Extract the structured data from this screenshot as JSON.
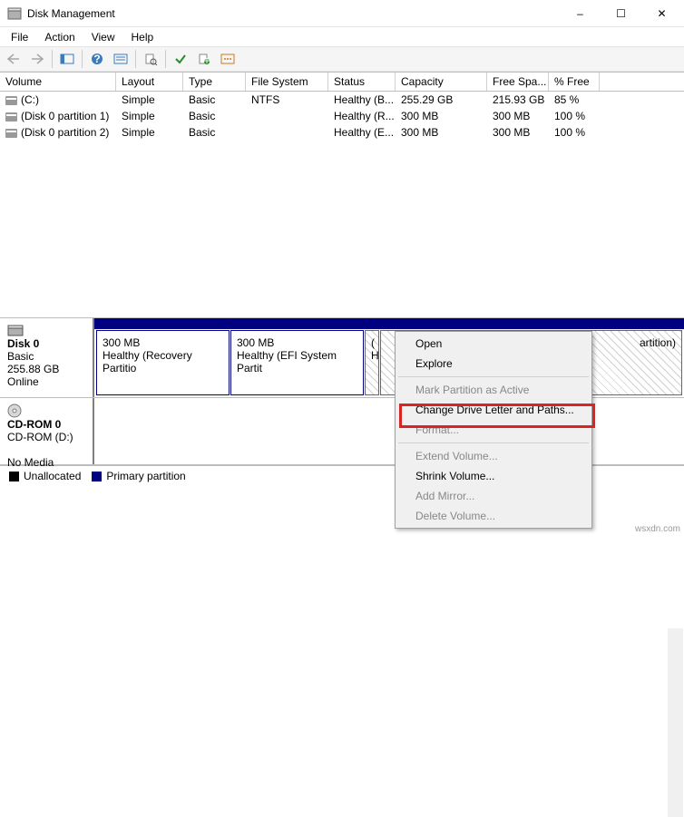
{
  "window": {
    "title": "Disk Management",
    "buttons": {
      "min": "–",
      "max": "☐",
      "close": "✕"
    }
  },
  "menu": {
    "file": "File",
    "action": "Action",
    "view": "View",
    "help": "Help"
  },
  "columns": {
    "volume": "Volume",
    "layout": "Layout",
    "type": "Type",
    "fs": "File System",
    "status": "Status",
    "capacity": "Capacity",
    "free": "Free Spa...",
    "pfree": "% Free"
  },
  "volumes": [
    {
      "name": "(C:)",
      "layout": "Simple",
      "type": "Basic",
      "fs": "NTFS",
      "status": "Healthy (B...",
      "capacity": "255.29 GB",
      "free": "215.93 GB",
      "pfree": "85 %"
    },
    {
      "name": "(Disk 0 partition 1)",
      "layout": "Simple",
      "type": "Basic",
      "fs": "",
      "status": "Healthy (R...",
      "capacity": "300 MB",
      "free": "300 MB",
      "pfree": "100 %"
    },
    {
      "name": "(Disk 0 partition 2)",
      "layout": "Simple",
      "type": "Basic",
      "fs": "",
      "status": "Healthy (E...",
      "capacity": "300 MB",
      "free": "300 MB",
      "pfree": "100 %"
    }
  ],
  "graphical": {
    "disk0": {
      "title": "Disk 0",
      "type": "Basic",
      "size": "255.88 GB",
      "state": "Online"
    },
    "parts": [
      {
        "size": "300 MB",
        "label": "Healthy (Recovery Partitio"
      },
      {
        "size": "300 MB",
        "label": "Healthy (EFI System Partit"
      },
      {
        "size": "(",
        "label": "H"
      },
      {
        "size": "",
        "label": "artition)"
      }
    ],
    "cdrom": {
      "title": "CD-ROM 0",
      "sub": "CD-ROM (D:)",
      "state": "No Media"
    }
  },
  "legend": {
    "unalloc": "Unallocated",
    "primary": "Primary partition"
  },
  "context": {
    "open": "Open",
    "explore": "Explore",
    "mark": "Mark Partition as Active",
    "change": "Change Drive Letter and Paths...",
    "format": "Format...",
    "extend": "Extend Volume...",
    "shrink": "Shrink Volume...",
    "mirror": "Add Mirror...",
    "delete": "Delete Volume..."
  },
  "watermark": "wsxdn.com"
}
